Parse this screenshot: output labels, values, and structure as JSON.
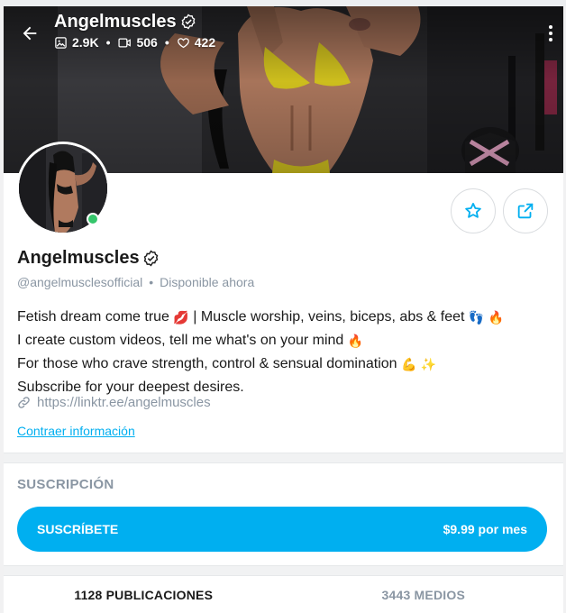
{
  "colors": {
    "accent": "#00aff0",
    "muted": "#8a96a3",
    "online": "#35c66b",
    "text": "#1a1a1a"
  },
  "header": {
    "name": "Angelmuscles",
    "stats": {
      "photos": "2.9K",
      "videos": "506",
      "likes": "422"
    },
    "icons": {
      "back": "arrow-left-icon",
      "photos": "image-icon",
      "videos": "video-icon",
      "likes": "heart-icon",
      "more": "more-vertical-icon"
    }
  },
  "profile": {
    "name": "Angelmuscles",
    "handle": "@angelmusclesofficial",
    "status": "Disponible ahora",
    "bio": [
      {
        "text": "Fetish dream come true ",
        "emoji": "💋",
        "rest": " | Muscle worship, veins, biceps, abs & feet ",
        "emoji2": "👣",
        "emoji3": "🔥"
      },
      {
        "text": "I create custom videos, tell me what's on your mind ",
        "emoji": "🔥"
      },
      {
        "text": "For those who crave strength, control & sensual domination ",
        "emoji": "💪",
        "emoji2": "✨"
      },
      {
        "text": "Subscribe for your deepest desires."
      }
    ],
    "link": "https://linktr.ee/angelmuscles",
    "collapse_label": "Contraer información",
    "icons": {
      "verified": "verified-badge-icon",
      "favorite": "star-icon",
      "share": "share-icon",
      "link": "link-icon"
    }
  },
  "subscription": {
    "title": "SUSCRIPCIÓN",
    "button_label": "SUSCRÍBETE",
    "price": "$9.99 por mes"
  },
  "tabs": [
    {
      "label": "1128 PUBLICACIONES",
      "active": true
    },
    {
      "label": "3443 MEDIOS",
      "active": false
    }
  ]
}
